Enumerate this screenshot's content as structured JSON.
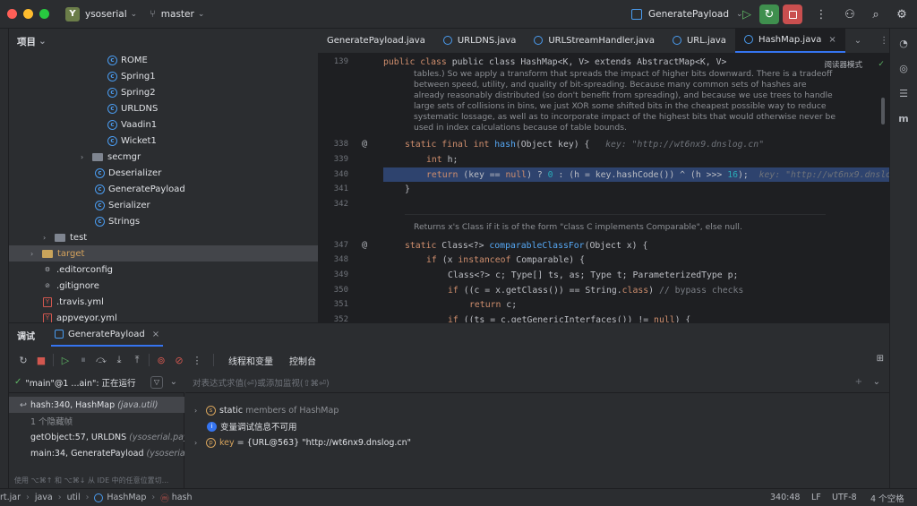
{
  "titlebar": {
    "project_badge": "Y",
    "project_name": "ysoserial",
    "branch": "master",
    "run_config": "GeneratePayload"
  },
  "project_panel": {
    "title": "项目",
    "items": [
      {
        "label": "ROME",
        "kind": "class"
      },
      {
        "label": "Spring1",
        "kind": "class"
      },
      {
        "label": "Spring2",
        "kind": "class"
      },
      {
        "label": "URLDNS",
        "kind": "class"
      },
      {
        "label": "Vaadin1",
        "kind": "class"
      },
      {
        "label": "Wicket1",
        "kind": "class"
      },
      {
        "label": "secmgr",
        "kind": "folder"
      },
      {
        "label": "Deserializer",
        "kind": "class"
      },
      {
        "label": "GeneratePayload",
        "kind": "class"
      },
      {
        "label": "Serializer",
        "kind": "class"
      },
      {
        "label": "Strings",
        "kind": "class"
      },
      {
        "label": "test",
        "kind": "folder"
      },
      {
        "label": "target",
        "kind": "folder-orange"
      },
      {
        "label": ".editorconfig",
        "kind": "settings"
      },
      {
        "label": ".gitignore",
        "kind": "ignore"
      },
      {
        "label": ".travis.yml",
        "kind": "yml"
      },
      {
        "label": "appveyor.yml",
        "kind": "yml"
      }
    ]
  },
  "editor": {
    "tabs": [
      {
        "label": "GeneratePayload.java",
        "active": false
      },
      {
        "label": "URLDNS.java",
        "active": false
      },
      {
        "label": "URLStreamHandler.java",
        "active": false
      },
      {
        "label": "URL.java",
        "active": false
      },
      {
        "label": "HashMap.java",
        "active": true
      }
    ],
    "reader_mode": "阅读器模式",
    "line_numbers": [
      "139",
      "338",
      "339",
      "340",
      "341",
      "342",
      "347",
      "348",
      "349",
      "350",
      "351",
      "352"
    ],
    "class_decl": "public class HashMap<K, V> extends AbstractMap<K, V>",
    "doc1": [
      "tables.) So we apply a transform that spreads the impact of higher bits downward. There is a tradeoff",
      "between speed, utility, and quality of bit-spreading. Because many common sets of hashes are",
      "already reasonably distributed (so don't benefit from spreading), and because we use trees to handle",
      "large sets of collisions in bins, we just XOR some shifted bits in the cheapest possible way to reduce",
      "systematic lossage, as well as to incorporate impact of the highest bits that would otherwise never be",
      "used in index calculations because of table bounds."
    ],
    "code_338": "static final int hash(Object key) {",
    "hint_338": "key: \"http://wt6nx9.dnslog.cn\"",
    "code_339": "int h;",
    "code_340": "return (key == null) ? 0 : (h = key.hashCode()) ^ (h >>> 16);",
    "hint_340": "key: \"http://wt6nx9.dnslog",
    "code_341": "}",
    "doc2": "Returns x's Class if it is of the form \"class C implements Comparable\", else null.",
    "code_347": "static Class<?> comparableClassFor(Object x) {",
    "code_348": "if (x instanceof Comparable) {",
    "code_349": "Class<?> c; Type[] ts, as; Type t; ParameterizedType p;",
    "code_350": "if ((c = x.getClass()) == String.class) // bypass checks",
    "code_351": "return c;",
    "code_352": "if ((ts = c.getGenericInterfaces()) != null) {"
  },
  "debug": {
    "title": "调试",
    "session_tab": "GeneratePayload",
    "sub_tabs": [
      "线程和变量",
      "控制台"
    ],
    "thread": "\"main\"@1 ...ain\": 正在运行",
    "eval_placeholder": "对表达式求值(⏎)或添加监视(⇧⌘⏎)",
    "frames": [
      {
        "method": "hash:340, HashMap",
        "class": "(java.util)"
      },
      {
        "method": "1 个隐藏帧",
        "class": ""
      },
      {
        "method": "getObject:57, URLDNS",
        "class": "(ysoserial.pay"
      },
      {
        "method": "main:34, GeneratePayload",
        "class": "(ysoserial)"
      }
    ],
    "hint": "使用 ⌥⌘↑ 和 ⌥⌘↓ 从 IDE 中的任意位置切...",
    "vars": [
      {
        "label": "static",
        "value": "members of HashMap"
      },
      {
        "label": "变量调试信息不可用",
        "value": ""
      },
      {
        "label": "key",
        "value": "= {URL@563} \"http://wt6nx9.dnslog.cn\""
      }
    ]
  },
  "statusbar": {
    "breadcrumb": [
      "rt.jar",
      "java",
      "util",
      "HashMap",
      "hash"
    ],
    "position": "340:48",
    "line_sep": "LF",
    "encoding": "UTF-8",
    "indent": "4 个空格"
  }
}
